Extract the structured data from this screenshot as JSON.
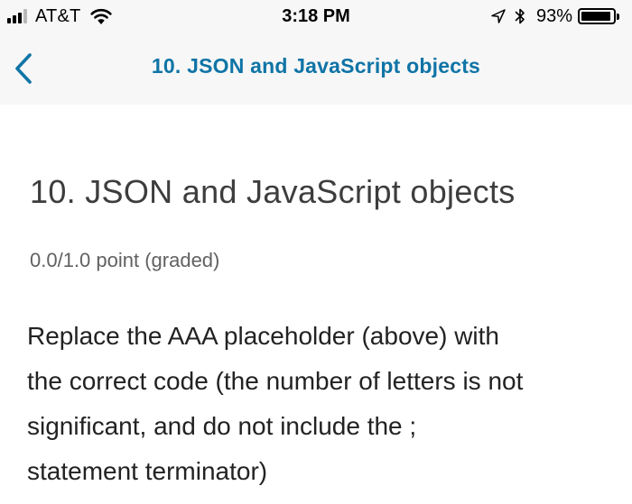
{
  "status_bar": {
    "carrier": "AT&T",
    "time": "3:18 PM",
    "battery_percent": "93%",
    "battery_level": 0.93,
    "signal_bars": 3,
    "icons": [
      "signal-icon",
      "wifi-icon",
      "location-arrow-icon",
      "bluetooth-icon",
      "battery-icon"
    ]
  },
  "nav": {
    "back_icon": "chevron-left-icon",
    "title": "10. JSON and JavaScript objects",
    "accent_color": "#0f74a6"
  },
  "problem": {
    "title": "10. JSON and JavaScript objects",
    "points": "0.0/1.0 point (graded)",
    "prompt_lines": [
      "Replace the AAA placeholder (above) with",
      "the correct code (the number of letters is not",
      "significant, and do not include the ;",
      "statement terminator)"
    ]
  }
}
